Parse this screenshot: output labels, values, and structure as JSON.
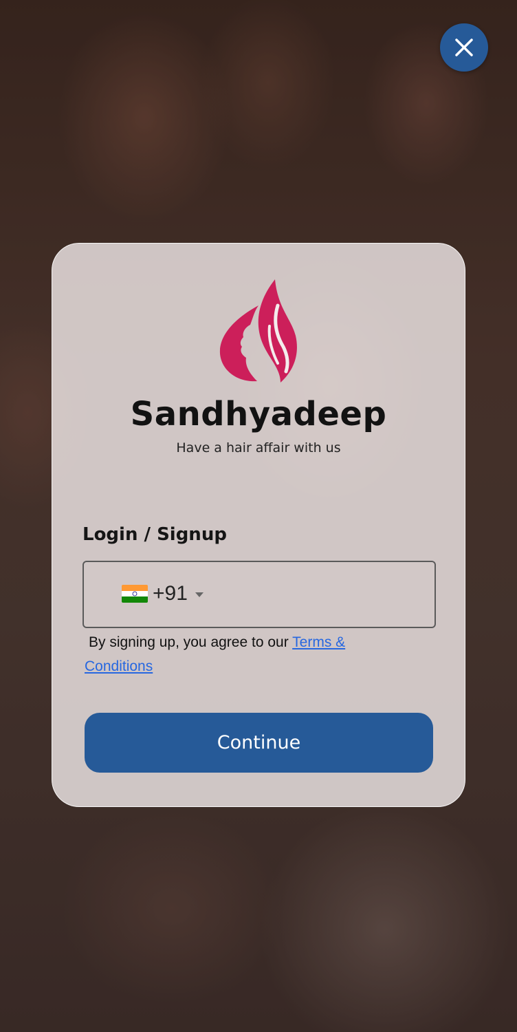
{
  "brand": {
    "name": "Sandhyadeep",
    "tagline": "Have a hair affair with us",
    "logo_icon": "woman-profile-flame-logo",
    "logo_color": "#cc1f5a"
  },
  "login": {
    "heading": "Login / Signup",
    "country_flag": "india-flag-icon",
    "dial_code": "+91",
    "phone_value": "",
    "terms_prefix": "By signing up, you agree to our ",
    "terms_link": "Terms & Conditions"
  },
  "actions": {
    "continue_label": "Continue",
    "close_icon": "close-icon"
  },
  "colors": {
    "primary": "#265a98",
    "link": "#2667e0"
  }
}
